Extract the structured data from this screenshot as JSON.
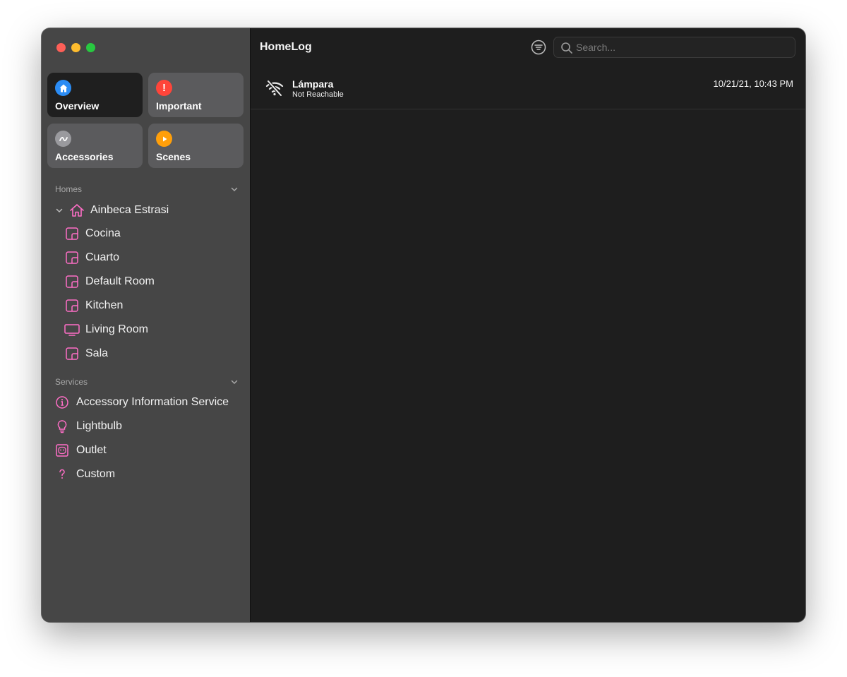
{
  "window": {
    "traffic_lights": {
      "close": "#fe5f57",
      "minimize": "#febc2e",
      "maximize": "#28c840"
    }
  },
  "sidebar": {
    "tiles": [
      {
        "label": "Overview",
        "icon": "house-icon",
        "color": "#2b8cf4",
        "active": true
      },
      {
        "label": "Important",
        "icon": "exclamation-icon",
        "glyph": "!",
        "color": "#ff453a",
        "active": false
      },
      {
        "label": "Accessories",
        "icon": "activity-icon",
        "color": "#9a9a9e",
        "active": false
      },
      {
        "label": "Scenes",
        "icon": "play-icon",
        "color": "#ff9f0a",
        "active": false
      }
    ],
    "homes_header": "Homes",
    "home": {
      "label": "Ainbeca Estrasi",
      "icon": "house-outline-icon"
    },
    "rooms": [
      {
        "label": "Cocina",
        "icon": "room-icon"
      },
      {
        "label": "Cuarto",
        "icon": "room-icon"
      },
      {
        "label": "Default Room",
        "icon": "room-icon"
      },
      {
        "label": "Kitchen",
        "icon": "room-icon"
      },
      {
        "label": "Living Room",
        "icon": "tv-icon"
      },
      {
        "label": "Sala",
        "icon": "room-icon"
      }
    ],
    "services_header": "Services",
    "services": [
      {
        "label": "Accessory Information Service",
        "icon": "info-icon"
      },
      {
        "label": "Lightbulb",
        "icon": "lightbulb-icon"
      },
      {
        "label": "Outlet",
        "icon": "outlet-icon"
      },
      {
        "label": "Custom",
        "icon": "question-icon"
      }
    ],
    "accent_color": "#ff6ec7"
  },
  "main": {
    "title": "HomeLog",
    "search": {
      "placeholder": "Search...",
      "value": ""
    },
    "log": [
      {
        "name": "Lámpara",
        "status": "Not Reachable",
        "time": "10/21/21, 10:43 PM",
        "icon": "wifi-off-icon"
      }
    ]
  }
}
